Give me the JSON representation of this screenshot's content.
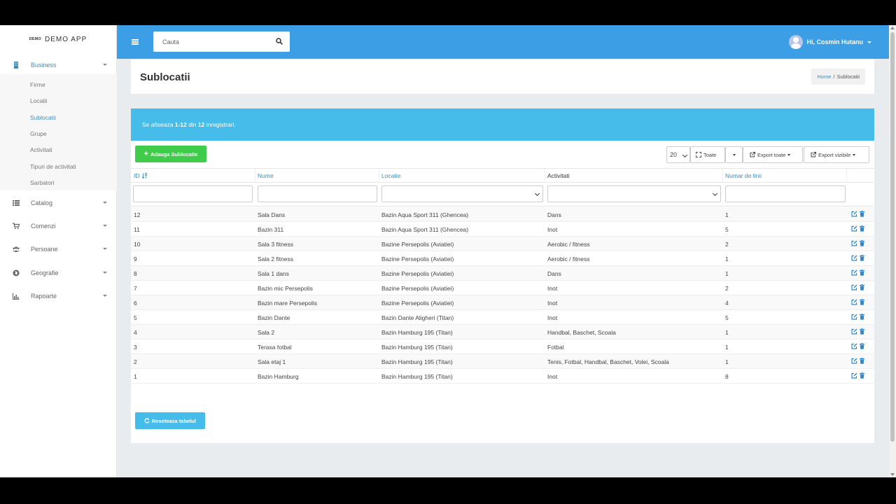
{
  "brand": {
    "mark": "DEMO",
    "name": "DEMO APP"
  },
  "sidebar": {
    "groups": [
      {
        "label": "Business",
        "icon": "building-icon",
        "active": true
      },
      {
        "label": "Catalog",
        "icon": "list-icon"
      },
      {
        "label": "Comenzi",
        "icon": "cart-icon"
      },
      {
        "label": "Persoane",
        "icon": "users-icon"
      },
      {
        "label": "Geografie",
        "icon": "globe-icon"
      },
      {
        "label": "Rapoarte",
        "icon": "chart-icon"
      }
    ],
    "business_items": [
      "Firme",
      "Locatii",
      "Sublocatii",
      "Grupe",
      "Activitati",
      "Tipuri de activitati",
      "Sarbatori"
    ],
    "active_item": "Sublocatii"
  },
  "topbar": {
    "search_placeholder": "Cauta",
    "user_label": "Hi, Cosmin Hutanu",
    "bg_color": "#3c9ee5"
  },
  "page": {
    "title": "Sublocatii",
    "breadcrumb_home": "Home",
    "breadcrumb_sep": "/",
    "breadcrumb_current": "Sublocatii"
  },
  "info": {
    "prefix": "Se afiseaza",
    "range": "1-12",
    "middle": "din",
    "total": "12",
    "suffix": "inregistrari."
  },
  "toolbar": {
    "add_label": "Adauga Sublocatie",
    "per_page": "20",
    "all_label": "Toate",
    "export_all": "Export toate",
    "export_visible": "Export vizibile",
    "reset_label": "Reseteaza tabelul"
  },
  "table": {
    "headers": {
      "id": "ID",
      "name": "Nume",
      "location": "Locatie",
      "activities": "Activitati",
      "lines": "Numar de linii"
    },
    "rows": [
      {
        "id": "12",
        "name": "Sala Dans",
        "location": "Bazin Aqua Sport 311 (Ghencea)",
        "activities": "Dans",
        "lines": "1"
      },
      {
        "id": "11",
        "name": "Bazin 311",
        "location": "Bazin Aqua Sport 311 (Ghencea)",
        "activities": "Inot",
        "lines": "5"
      },
      {
        "id": "10",
        "name": "Sala 3 fitness",
        "location": "Bazine Persepolis (Aviatiei)",
        "activities": "Aerobic / fitness",
        "lines": "2"
      },
      {
        "id": "9",
        "name": "Sala 2 fitness",
        "location": "Bazine Persepolis (Aviatiei)",
        "activities": "Aerobic / fitness",
        "lines": "1"
      },
      {
        "id": "8",
        "name": "Sala 1 dans",
        "location": "Bazine Persepolis (Aviatiei)",
        "activities": "Dans",
        "lines": "1"
      },
      {
        "id": "7",
        "name": "Bazin mic Persepolis",
        "location": "Bazine Persepolis (Aviatiei)",
        "activities": "Inot",
        "lines": "2"
      },
      {
        "id": "6",
        "name": "Bazin mare Persepolis",
        "location": "Bazine Persepolis (Aviatiei)",
        "activities": "Inot",
        "lines": "4"
      },
      {
        "id": "5",
        "name": "Bazin Dante",
        "location": "Bazin Dante Aligheri (Titan)",
        "activities": "Inot",
        "lines": "5"
      },
      {
        "id": "4",
        "name": "Sala 2",
        "location": "Bazin Hamburg 195 (Titan)",
        "activities": "Handbal, Baschet, Scoala",
        "lines": "1"
      },
      {
        "id": "3",
        "name": "Terasa fotbal",
        "location": "Bazin Hamburg 195 (Titan)",
        "activities": "Fotbal",
        "lines": "1"
      },
      {
        "id": "2",
        "name": "Sala etaj 1",
        "location": "Bazin Hamburg 195 (Titan)",
        "activities": "Tenis, Fotbal, Handbal, Baschet, Volei, Scoala",
        "lines": "1"
      },
      {
        "id": "1",
        "name": "Bazin Hamburg",
        "location": "Bazin Hamburg 195 (Titan)",
        "activities": "Inot",
        "lines": "8"
      }
    ]
  },
  "colors": {
    "accent": "#3c8dbc",
    "add_button": "#3ecc4a",
    "info_strip": "#46bceb"
  }
}
